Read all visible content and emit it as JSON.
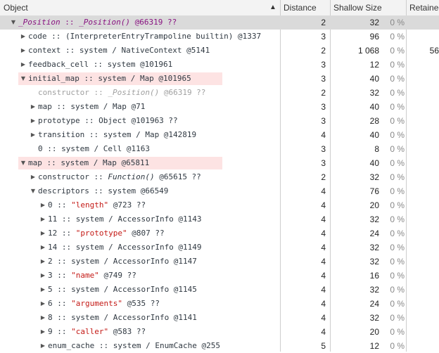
{
  "header": {
    "object": "Object",
    "distance": "Distance",
    "shallow": "Shallow Size",
    "retained": "Retainec"
  },
  "rows": [
    {
      "indent": 0,
      "tri": "open",
      "selected": true,
      "accent": true,
      "parts": [
        {
          "t": "_Position",
          "i": true
        },
        {
          "t": " :: "
        },
        {
          "t": "_Position()",
          "i": true
        },
        {
          "t": " @66319 ??"
        }
      ],
      "distance": "2",
      "shallow": "32",
      "pct": "0 %",
      "retained": ""
    },
    {
      "indent": 1,
      "tri": "closed",
      "parts": [
        {
          "t": "code :: (InterpreterEntryTrampoline builtin) @1337"
        }
      ],
      "distance": "3",
      "shallow": "96",
      "pct": "0 %",
      "retained": ""
    },
    {
      "indent": 1,
      "tri": "closed",
      "parts": [
        {
          "t": "context :: system / NativeContext @5141"
        }
      ],
      "distance": "2",
      "shallow": "1 068",
      "pct": "0 %",
      "retained": "56"
    },
    {
      "indent": 1,
      "tri": "closed",
      "parts": [
        {
          "t": "feedback_cell :: system @101961"
        }
      ],
      "distance": "3",
      "shallow": "12",
      "pct": "0 %",
      "retained": ""
    },
    {
      "indent": 1,
      "tri": "open",
      "hl": 290,
      "parts": [
        {
          "t": "initial_map :: system / Map @101965"
        }
      ],
      "distance": "3",
      "shallow": "40",
      "pct": "0 %",
      "retained": ""
    },
    {
      "indent": 2,
      "tri": "none",
      "dim": true,
      "parts": [
        {
          "t": "constructor :: "
        },
        {
          "t": "_Position()",
          "i": true
        },
        {
          "t": " @66319 ??"
        }
      ],
      "distance": "2",
      "shallow": "32",
      "pct": "0 %",
      "retained": ""
    },
    {
      "indent": 2,
      "tri": "closed",
      "parts": [
        {
          "t": "map :: system / Map @71"
        }
      ],
      "distance": "3",
      "shallow": "40",
      "pct": "0 %",
      "retained": ""
    },
    {
      "indent": 2,
      "tri": "closed",
      "parts": [
        {
          "t": "prototype :: Object @101963 ??"
        }
      ],
      "distance": "3",
      "shallow": "28",
      "pct": "0 %",
      "retained": ""
    },
    {
      "indent": 2,
      "tri": "closed",
      "parts": [
        {
          "t": "transition :: system / Map @142819"
        }
      ],
      "distance": "4",
      "shallow": "40",
      "pct": "0 %",
      "retained": ""
    },
    {
      "indent": 2,
      "tri": "none",
      "parts": [
        {
          "t": "0 :: system / Cell @1163"
        }
      ],
      "distance": "3",
      "shallow": "8",
      "pct": "0 %",
      "retained": ""
    },
    {
      "indent": 1,
      "tri": "open",
      "hl": 290,
      "parts": [
        {
          "t": "map :: system / Map @65811"
        }
      ],
      "distance": "3",
      "shallow": "40",
      "pct": "0 %",
      "retained": ""
    },
    {
      "indent": 2,
      "tri": "closed",
      "parts": [
        {
          "t": "constructor :: "
        },
        {
          "t": "Function()",
          "i": true
        },
        {
          "t": " @65615 ??"
        }
      ],
      "distance": "2",
      "shallow": "32",
      "pct": "0 %",
      "retained": ""
    },
    {
      "indent": 2,
      "tri": "open",
      "parts": [
        {
          "t": "descriptors :: system @66549"
        }
      ],
      "distance": "4",
      "shallow": "76",
      "pct": "0 %",
      "retained": ""
    },
    {
      "indent": 3,
      "tri": "closed",
      "parts": [
        {
          "t": "0 :: "
        },
        {
          "t": "\"length\"",
          "s": true
        },
        {
          "t": " @723 ??"
        }
      ],
      "distance": "4",
      "shallow": "20",
      "pct": "0 %",
      "retained": ""
    },
    {
      "indent": 3,
      "tri": "closed",
      "parts": [
        {
          "t": "11 :: system / AccessorInfo @1143"
        }
      ],
      "distance": "4",
      "shallow": "32",
      "pct": "0 %",
      "retained": ""
    },
    {
      "indent": 3,
      "tri": "closed",
      "parts": [
        {
          "t": "12 :: "
        },
        {
          "t": "\"prototype\"",
          "s": true
        },
        {
          "t": " @807 ??"
        }
      ],
      "distance": "4",
      "shallow": "24",
      "pct": "0 %",
      "retained": ""
    },
    {
      "indent": 3,
      "tri": "closed",
      "parts": [
        {
          "t": "14 :: system / AccessorInfo @1149"
        }
      ],
      "distance": "4",
      "shallow": "32",
      "pct": "0 %",
      "retained": ""
    },
    {
      "indent": 3,
      "tri": "closed",
      "parts": [
        {
          "t": "2 :: system / AccessorInfo @1147"
        }
      ],
      "distance": "4",
      "shallow": "32",
      "pct": "0 %",
      "retained": ""
    },
    {
      "indent": 3,
      "tri": "closed",
      "parts": [
        {
          "t": "3 :: "
        },
        {
          "t": "\"name\"",
          "s": true
        },
        {
          "t": " @749 ??"
        }
      ],
      "distance": "4",
      "shallow": "16",
      "pct": "0 %",
      "retained": ""
    },
    {
      "indent": 3,
      "tri": "closed",
      "parts": [
        {
          "t": "5 :: system / AccessorInfo @1145"
        }
      ],
      "distance": "4",
      "shallow": "32",
      "pct": "0 %",
      "retained": ""
    },
    {
      "indent": 3,
      "tri": "closed",
      "parts": [
        {
          "t": "6 :: "
        },
        {
          "t": "\"arguments\"",
          "s": true
        },
        {
          "t": " @535 ??"
        }
      ],
      "distance": "4",
      "shallow": "24",
      "pct": "0 %",
      "retained": ""
    },
    {
      "indent": 3,
      "tri": "closed",
      "parts": [
        {
          "t": "8 :: system / AccessorInfo @1141"
        }
      ],
      "distance": "4",
      "shallow": "32",
      "pct": "0 %",
      "retained": ""
    },
    {
      "indent": 3,
      "tri": "closed",
      "parts": [
        {
          "t": "9 :: "
        },
        {
          "t": "\"caller\"",
          "s": true
        },
        {
          "t": " @583 ??"
        }
      ],
      "distance": "4",
      "shallow": "20",
      "pct": "0 %",
      "retained": ""
    },
    {
      "indent": 3,
      "tri": "closed",
      "parts": [
        {
          "t": "enum_cache :: system / EnumCache @255"
        }
      ],
      "distance": "5",
      "shallow": "12",
      "pct": "0 %",
      "retained": ""
    }
  ]
}
